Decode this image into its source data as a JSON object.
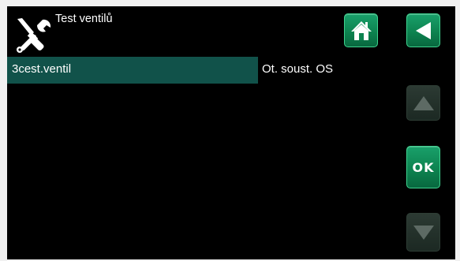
{
  "header": {
    "title": "Test ventilů",
    "icon": "wrench-screwdriver-icon"
  },
  "nav": {
    "home_icon": "home-icon",
    "back_icon": "back-arrow-icon",
    "up_icon": "arrow-up-icon",
    "down_icon": "arrow-down-icon",
    "ok_label": "OK"
  },
  "list": {
    "rows": [
      {
        "label": "3cest.ventil",
        "value": "Ot. soust. OS",
        "selected": true
      }
    ]
  },
  "colors": {
    "background": "#000000",
    "selected_row": "#11524a",
    "button_active": "#0d8350",
    "button_disabled": "#22302a"
  }
}
